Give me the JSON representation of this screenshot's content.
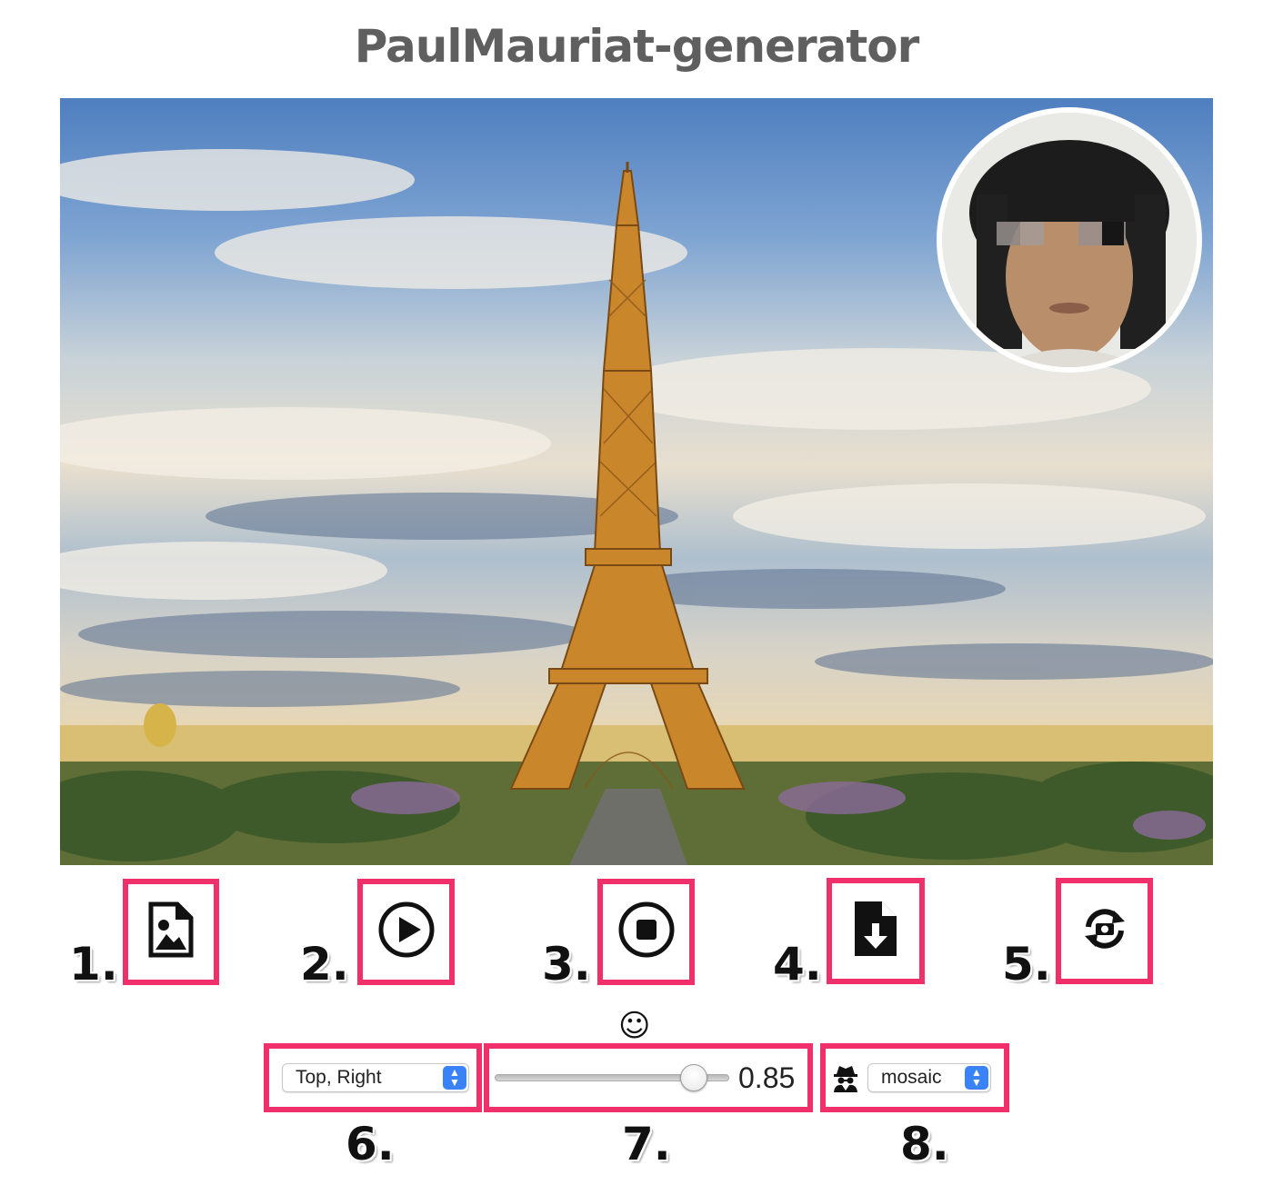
{
  "app": {
    "title": "PaulMauriat-generator"
  },
  "toolbar": {
    "buttons": [
      {
        "number": "1.",
        "icon": "file-image-icon"
      },
      {
        "number": "2.",
        "icon": "play-circle-icon"
      },
      {
        "number": "3.",
        "icon": "stop-circle-icon"
      },
      {
        "number": "4.",
        "icon": "file-download-icon"
      },
      {
        "number": "5.",
        "icon": "camera-switch-icon"
      }
    ]
  },
  "controls": {
    "position_select": {
      "value": "Top, Right",
      "number": "6."
    },
    "face_icon": "☺",
    "scale_slider": {
      "value": "0.85",
      "fraction": 0.85,
      "number": "7."
    },
    "filter_select": {
      "value": "mosaic",
      "icon": "spy-icon",
      "number": "8."
    }
  },
  "colors": {
    "highlight": "#f0306a",
    "title": "#5f5f5f",
    "select_accent": "#3a82f7"
  }
}
